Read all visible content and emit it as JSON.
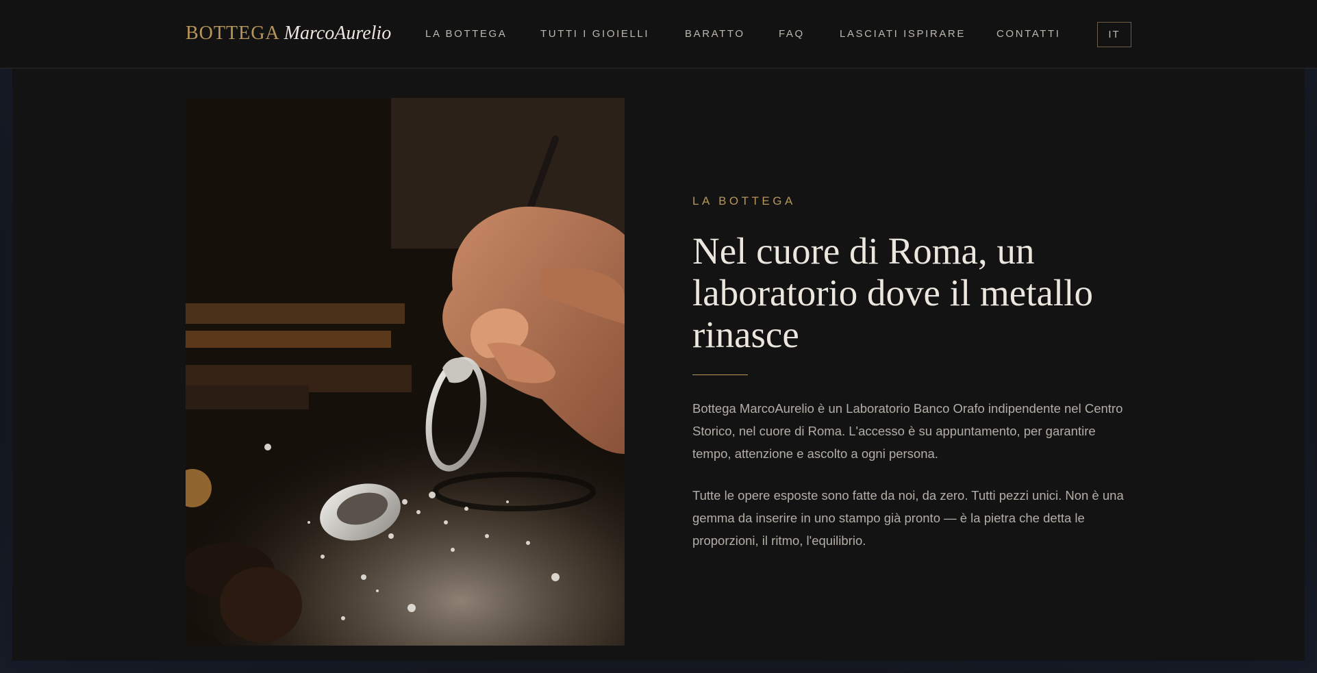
{
  "brand": {
    "part1": "BOTTEGA",
    "part2": "MarcoAurelio"
  },
  "nav": {
    "items": [
      {
        "label": "LA BOTTEGA"
      },
      {
        "label": "TUTTI I GIOIELLI"
      },
      {
        "label": "BARATTO"
      },
      {
        "label": "FAQ"
      },
      {
        "label": "LASCIATI ISPIRARE"
      },
      {
        "label": "CONTATTI"
      }
    ],
    "lang": "IT"
  },
  "hero": {
    "eyebrow": "LA BOTTEGA",
    "title": "Nel cuore di Roma, un laboratorio dove il metallo rinasce",
    "paragraphs": [
      "Bottega MarcoAurelio è un Laboratorio Banco Orafo indipendente nel Centro Storico, nel cuore di Roma. L'accesso è su appuntamento, per garantire tempo, attenzione e ascolto a ogni persona.",
      "Tutte le opere esposte sono fatte da noi, da zero. Tutti pezzi unici. Non è una gemma da inserire in uno stampo già pronto — è la pietra che detta le proporzioni, il ritmo, l'equilibrio."
    ]
  },
  "colors": {
    "accent": "#b8965a",
    "background": "#131313",
    "text": "#ece7de",
    "muted": "#b3aea6"
  }
}
